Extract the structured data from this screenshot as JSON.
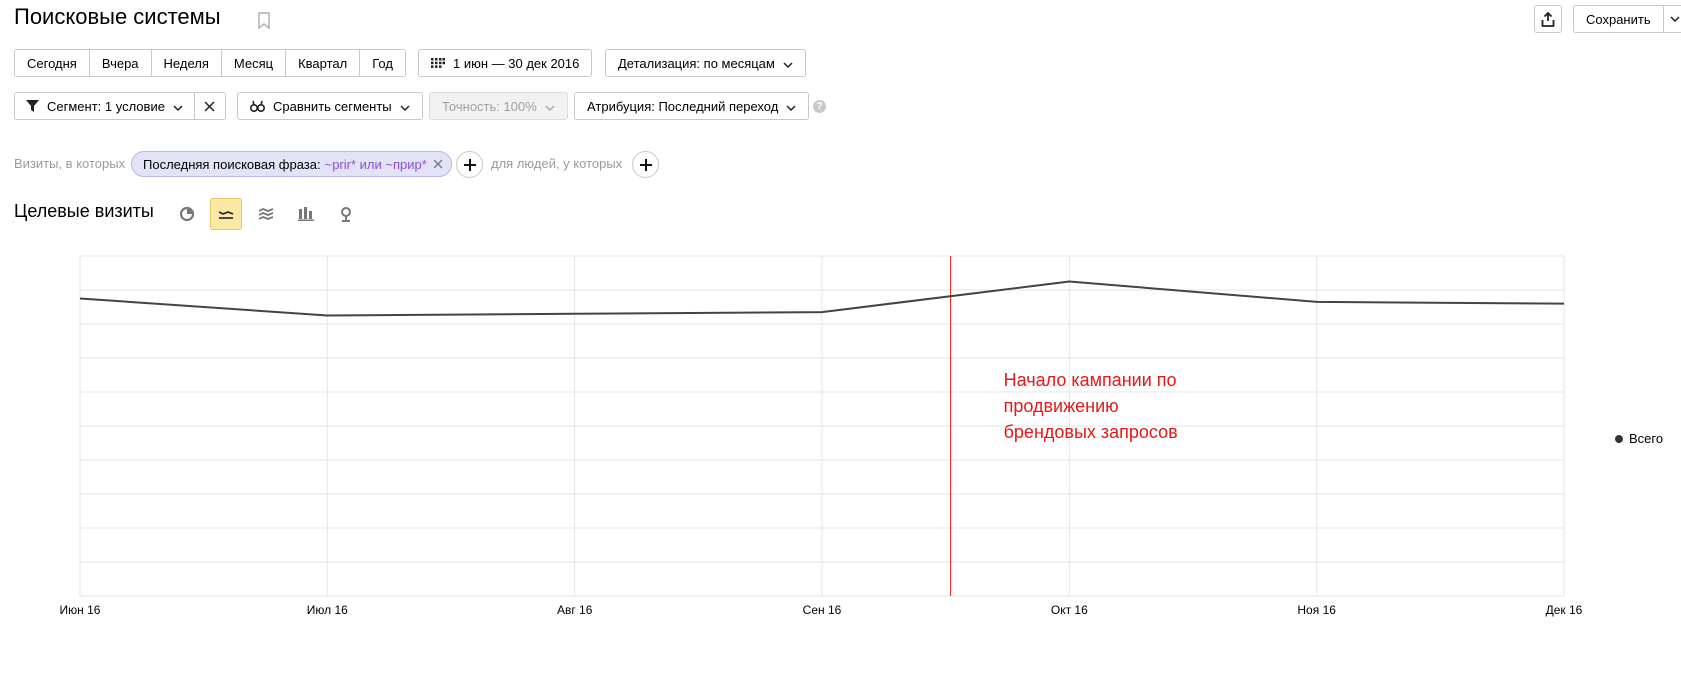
{
  "header": {
    "title": "Поисковые системы",
    "save_label": "Сохранить"
  },
  "periods": [
    "Сегодня",
    "Вчера",
    "Неделя",
    "Месяц",
    "Квартал",
    "Год"
  ],
  "date_range": "1 июн — 30 дек 2016",
  "detail": "Детализация: по месяцам",
  "segment": {
    "label": "Сегмент: 1 условие",
    "compare": "Сравнить сегменты",
    "accuracy": "Точность: 100%",
    "attribution": "Атрибуция: Последний переход",
    "help": "?"
  },
  "filter": {
    "visits_label": "Визиты, в которых",
    "chip_label": "Последняя поисковая фраза:",
    "chip_value": "~prir* или ~прир*",
    "people_label": "для людей, у которых"
  },
  "chart_title": "Целевые визиты",
  "view_icons": [
    "pie-chart-icon",
    "line-chart-icon",
    "area-chart-icon",
    "bar-chart-icon",
    "map-icon"
  ],
  "annotation": {
    "lines": [
      "Начало кампании по",
      "продвижению",
      "брендовых запросов"
    ],
    "color": "#e01919"
  },
  "chart_data": {
    "type": "line",
    "categories": [
      "Июн 16",
      "Июл 16",
      "Авг 16",
      "Сен 16",
      "Окт 16",
      "Ноя 16",
      "Дек 16"
    ],
    "series": [
      {
        "name": "Всего",
        "values": [
          0.875,
          0.825,
          0.83,
          0.835,
          0.925,
          0.865,
          0.86
        ]
      }
    ],
    "ylim": [
      0,
      1
    ],
    "grid": true,
    "legend_position": "right",
    "annotation_x": 3.52
  }
}
